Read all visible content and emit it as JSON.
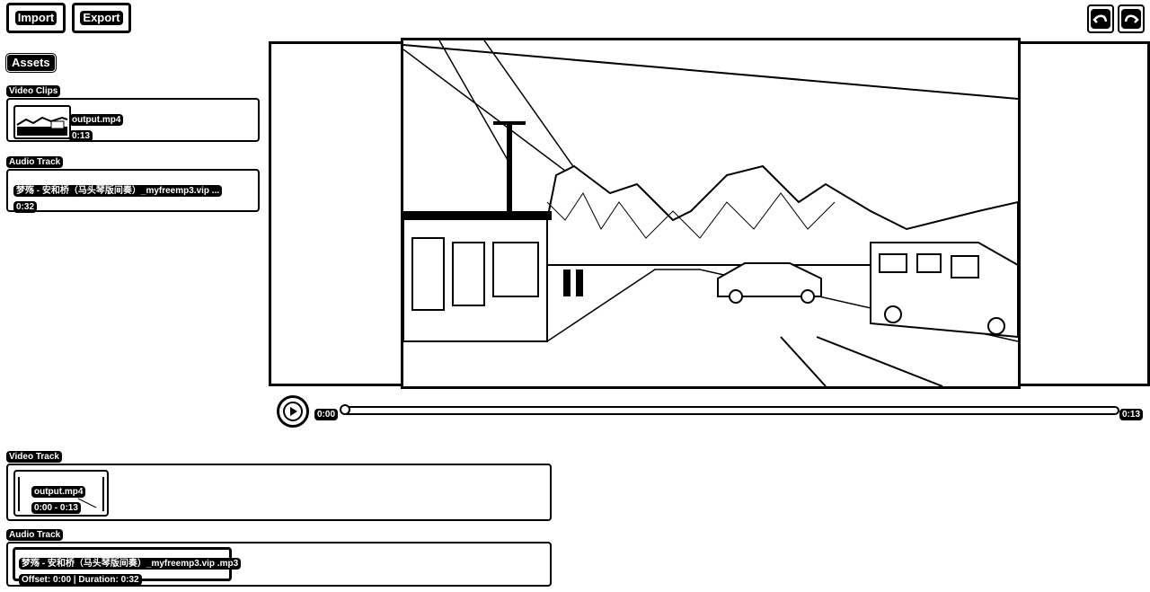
{
  "toolbar": {
    "import_label": "Import",
    "export_label": "Export",
    "undo_icon": "undo-icon",
    "redo_icon": "redo-icon"
  },
  "assets": {
    "title": "Assets",
    "video_clips_label": "Video Clips",
    "video_clip": {
      "name": "output.mp4",
      "duration": "0:13"
    },
    "audio_track_label": "Audio Track",
    "audio_clip": {
      "name": "梦殇 - 安和桥（马头琴版间奏）_myfreemp3.vip ...",
      "duration": "0:32"
    }
  },
  "player": {
    "current_time": "0:00",
    "total_time": "0:13",
    "progress": 0.0,
    "play_icon": "play-icon"
  },
  "timeline": {
    "video_track_label": "Video Track",
    "video_clip": {
      "name": "output.mp4",
      "range": "0:00 - 0:13"
    },
    "audio_track_label": "Audio Track",
    "audio_clip": {
      "name": "梦殇 - 安和桥（马头琴版间奏）_myfreemp3.vip .mp3",
      "info": "Offset: 0:00 | Duration: 0:32"
    }
  }
}
